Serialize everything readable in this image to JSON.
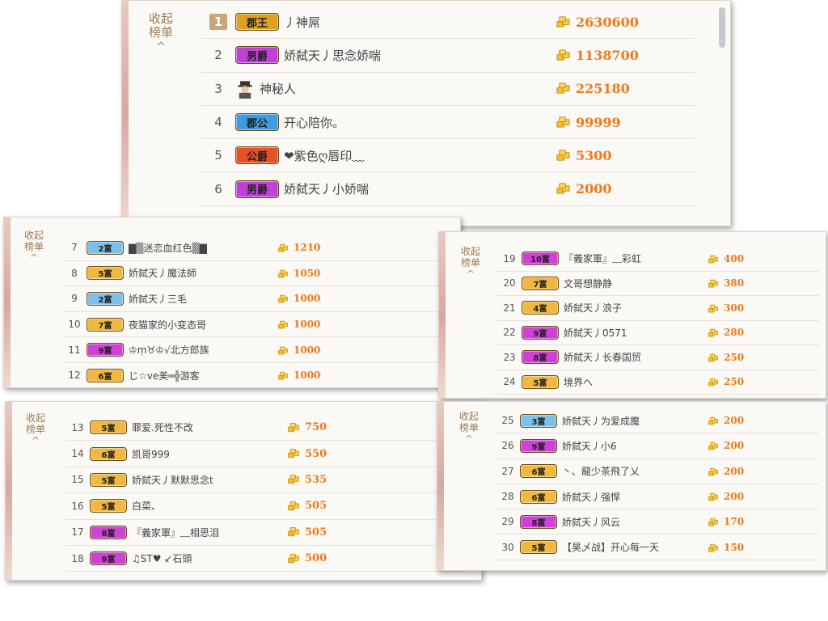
{
  "collapse_label": "收起",
  "board_label": "榜单",
  "caret": "^",
  "colors": {
    "score": "#f07818",
    "gold": "#f2c12e",
    "text": "#444444",
    "side": "#9b7a55"
  },
  "icons": {
    "coin": "gold-ingot-icon",
    "avatar": "mystery-person-icon"
  },
  "panels": [
    {
      "id": "panel-a",
      "rows": [
        {
          "rank": "1",
          "badge": "郡王",
          "badge_color": "#e0a020",
          "name": "丿神屌",
          "score": "2630600"
        },
        {
          "rank": "2",
          "badge": "男爵",
          "badge_color": "#c040d8",
          "name": "娇弑天丿思念娇喘",
          "score": "1138700"
        },
        {
          "rank": "3",
          "badge": "",
          "badge_color": "",
          "name": "神秘人",
          "score": "225180"
        },
        {
          "rank": "4",
          "badge": "郡公",
          "badge_color": "#3a9ee0",
          "name": "开心陪你。",
          "score": "99999"
        },
        {
          "rank": "5",
          "badge": "公爵",
          "badge_color": "#e8502a",
          "name": "❤紫色ღ唇印﹏",
          "score": "5300"
        },
        {
          "rank": "6",
          "badge": "男爵",
          "badge_color": "#c040d8",
          "name": "娇弑天丿小娇喘",
          "score": "2000"
        }
      ]
    },
    {
      "id": "panel-b",
      "rows": [
        {
          "rank": "7",
          "badge": "2富",
          "badge_color": "#7cc0e8",
          "name": "▇▒迷恋血红色▒▇",
          "score": "1210"
        },
        {
          "rank": "8",
          "badge": "5富",
          "badge_color": "#f0b840",
          "name": "娇弑天丿魔法師",
          "score": "1050"
        },
        {
          "rank": "9",
          "badge": "2富",
          "badge_color": "#7cc0e8",
          "name": "娇弑天丿三毛",
          "score": "1000"
        },
        {
          "rank": "10",
          "badge": "7富",
          "badge_color": "#f0b840",
          "name": "夜猫家的小变态哥",
          "score": "1000"
        },
        {
          "rank": "11",
          "badge": "9富",
          "badge_color": "#d040d8",
          "name": "♔ṃ♉♔√北方郎族",
          "score": "1000"
        },
        {
          "rank": "12",
          "badge": "6富",
          "badge_color": "#f0b840",
          "name": "じ☆ve美═╬游客",
          "score": "1000"
        }
      ]
    },
    {
      "id": "panel-c",
      "rows": [
        {
          "rank": "13",
          "badge": "5富",
          "badge_color": "#f0b840",
          "name": "罪爱.死性不改",
          "score": "750"
        },
        {
          "rank": "14",
          "badge": "6富",
          "badge_color": "#f0b840",
          "name": "凯哥999",
          "score": "550"
        },
        {
          "rank": "15",
          "badge": "5富",
          "badge_color": "#f0b840",
          "name": "娇弑天丿默默思念t",
          "score": "535"
        },
        {
          "rank": "16",
          "badge": "5富",
          "badge_color": "#f0b840",
          "name": "白菜、",
          "score": "505"
        },
        {
          "rank": "17",
          "badge": "8富",
          "badge_color": "#d040d8",
          "name": "『義家軍』﹏相思泪",
          "score": "505"
        },
        {
          "rank": "18",
          "badge": "9富",
          "badge_color": "#d040d8",
          "name": "♫ST♥ ↙石頭",
          "score": "500"
        }
      ]
    },
    {
      "id": "panel-d",
      "rows": [
        {
          "rank": "19",
          "badge": "10富",
          "badge_color": "#d040d8",
          "name": "『義家軍』﹏彩虹",
          "score": "400"
        },
        {
          "rank": "20",
          "badge": "7富",
          "badge_color": "#f0b840",
          "name": "文哥想静静",
          "score": "380"
        },
        {
          "rank": "21",
          "badge": "4富",
          "badge_color": "#f0b840",
          "name": "娇弑天丿浪子",
          "score": "300"
        },
        {
          "rank": "22",
          "badge": "9富",
          "badge_color": "#d040d8",
          "name": "娇弑天丿0571",
          "score": "280"
        },
        {
          "rank": "23",
          "badge": "8富",
          "badge_color": "#d040d8",
          "name": "娇弑天丿长春国贸",
          "score": "250"
        },
        {
          "rank": "24",
          "badge": "5富",
          "badge_color": "#f0b840",
          "name": "境界へ",
          "score": "250"
        }
      ]
    },
    {
      "id": "panel-e",
      "rows": [
        {
          "rank": "25",
          "badge": "3富",
          "badge_color": "#7cc0e8",
          "name": "娇弑天丿为爱成魔",
          "score": "200"
        },
        {
          "rank": "26",
          "badge": "9富",
          "badge_color": "#d040d8",
          "name": "娇弑天丿小6",
          "score": "200"
        },
        {
          "rank": "27",
          "badge": "6富",
          "badge_color": "#f0b840",
          "name": "丶、龍少茶飛了乂",
          "score": "200"
        },
        {
          "rank": "28",
          "badge": "6富",
          "badge_color": "#f0b840",
          "name": "娇弑天丿强悍",
          "score": "200"
        },
        {
          "rank": "29",
          "badge": "8富",
          "badge_color": "#d040d8",
          "name": "娇弑天丿风云",
          "score": "170"
        },
        {
          "rank": "30",
          "badge": "5富",
          "badge_color": "#f0b840",
          "name": "【昊乄战】开心每一天",
          "score": "150"
        }
      ]
    }
  ]
}
